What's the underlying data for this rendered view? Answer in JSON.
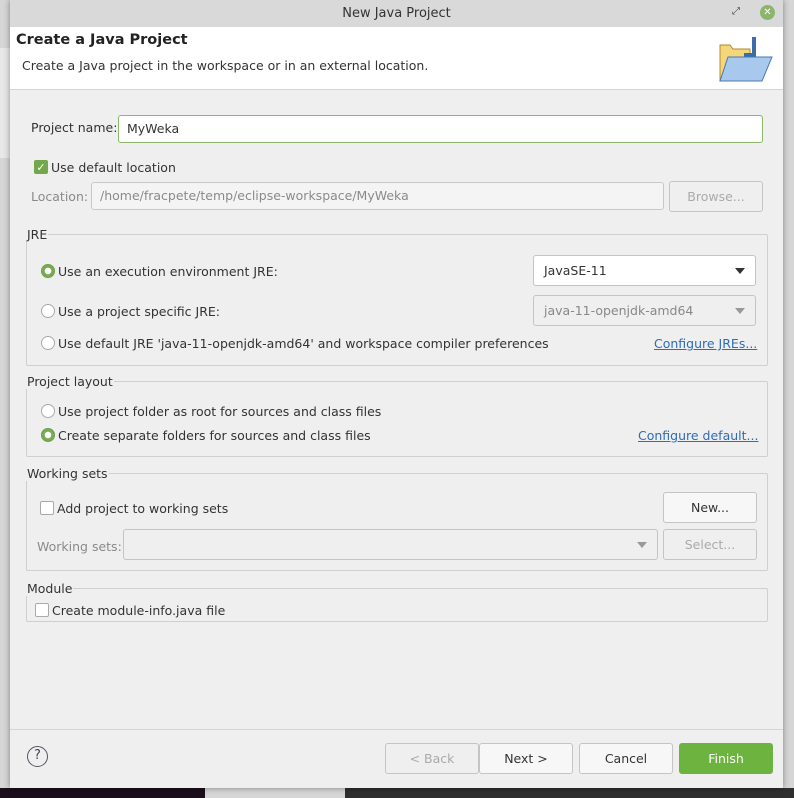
{
  "window": {
    "title": "New Java Project"
  },
  "header": {
    "title": "Create a Java Project",
    "description": "Create a Java project in the workspace or in an external location."
  },
  "project_name": {
    "label": "Project name:",
    "value": "MyWeka"
  },
  "default_location": {
    "label": "Use default location",
    "checked": true
  },
  "location": {
    "label": "Location:",
    "value": "/home/fracpete/temp/eclipse-workspace/MyWeka",
    "browse": "Browse..."
  },
  "jre": {
    "title": "JRE",
    "opt1": "Use an execution environment JRE:",
    "opt1_value": "JavaSE-11",
    "opt2": "Use a project specific JRE:",
    "opt2_value": "java-11-openjdk-amd64",
    "opt3": "Use default JRE 'java-11-openjdk-amd64' and workspace compiler preferences",
    "configure": "Configure JREs...",
    "selected": "opt1"
  },
  "layout": {
    "title": "Project layout",
    "opt1": "Use project folder as root for sources and class files",
    "opt2": "Create separate folders for sources and class files",
    "configure": "Configure default...",
    "selected": "opt2"
  },
  "working_sets": {
    "title": "Working sets",
    "add_label": "Add project to working sets",
    "checked": false,
    "new": "New...",
    "sets_label": "Working sets:",
    "select": "Select..."
  },
  "module": {
    "title": "Module",
    "label": "Create module-info.java file",
    "checked": false
  },
  "buttons": {
    "back": "< Back",
    "next": "Next >",
    "cancel": "Cancel",
    "finish": "Finish"
  },
  "colors": {
    "accent": "#6db33f",
    "link": "#2f6db5"
  }
}
